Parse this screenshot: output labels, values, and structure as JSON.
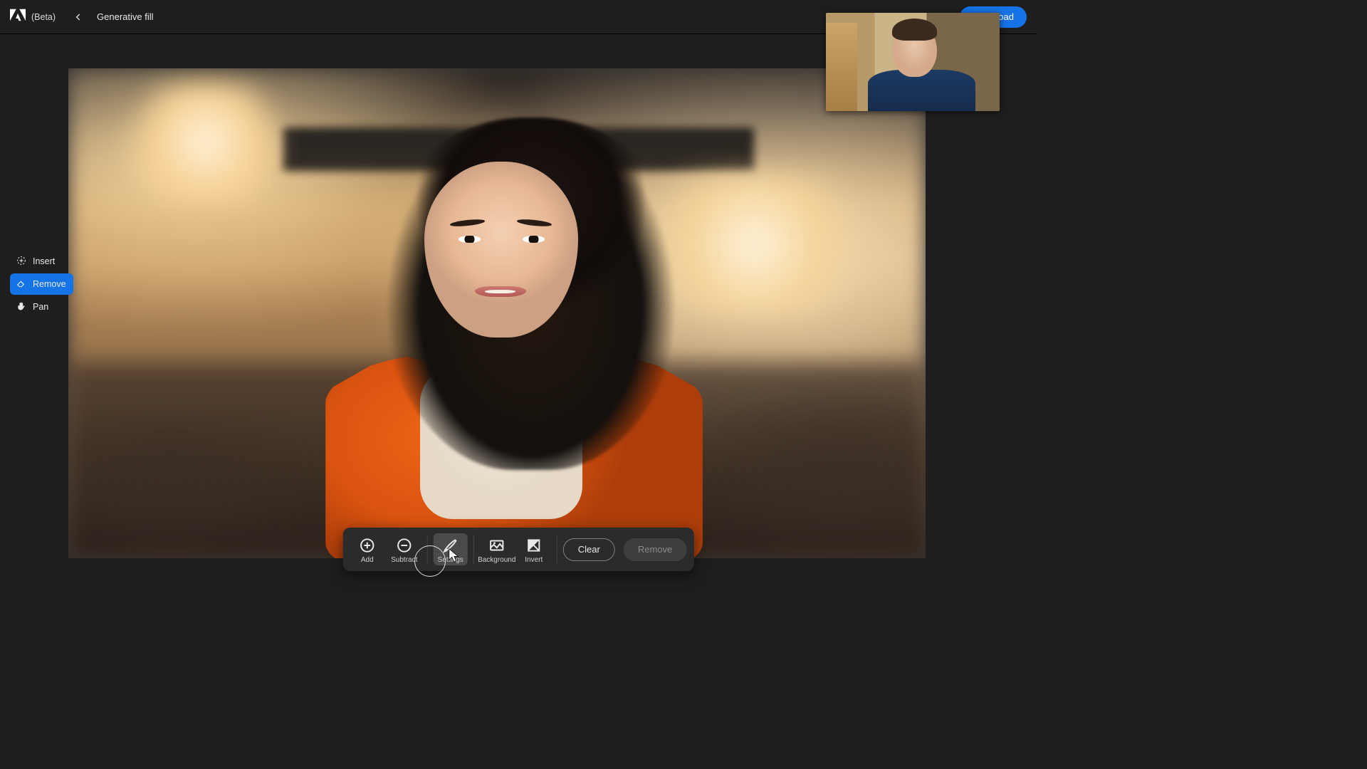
{
  "header": {
    "beta_label": "(Beta)",
    "page_title": "Generative fill",
    "download_label": "Download"
  },
  "side_tools": {
    "insert_label": "Insert",
    "remove_label": "Remove",
    "pan_label": "Pan",
    "active": "remove"
  },
  "bottom_bar": {
    "add_label": "Add",
    "subtract_label": "Subtract",
    "settings_label": "Settings",
    "background_label": "Background",
    "invert_label": "Invert",
    "clear_label": "Clear",
    "remove_label": "Remove",
    "active": "settings"
  }
}
